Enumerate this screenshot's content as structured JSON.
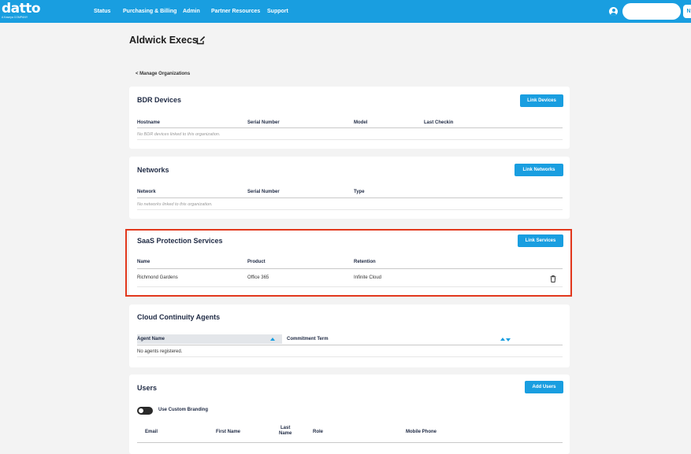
{
  "brand": {
    "logo": "datto",
    "logo_sub": "A Kaseya COMPANY"
  },
  "nav": {
    "items": [
      "Status",
      "Purchasing & Billing",
      "Admin",
      "Partner Resources",
      "Support"
    ]
  },
  "header": {
    "user_button": "N",
    "search_placeholder": ""
  },
  "page": {
    "title": "Aldwick Execs",
    "back_link": "< Manage Organizations"
  },
  "bdr": {
    "title": "BDR Devices",
    "button": "Link Devices",
    "columns": [
      "Hostname",
      "Serial Number",
      "Model",
      "Last Checkin"
    ],
    "empty": "No BDR devices linked to this organization."
  },
  "networks": {
    "title": "Networks",
    "button": "Link Networks",
    "columns": [
      "Network",
      "Serial Number",
      "Type"
    ],
    "empty": "No networks linked to this organization."
  },
  "saas": {
    "title": "SaaS Protection Services",
    "button": "Link Services",
    "columns": [
      "Name",
      "Product",
      "Retention"
    ],
    "rows": [
      {
        "name": "Richmond Gardens",
        "product": "Office 365",
        "retention": "Infinite Cloud"
      }
    ]
  },
  "cloud": {
    "title": "Cloud Continuity Agents",
    "columns": [
      "Agent Name",
      "Commitment Term"
    ],
    "empty": "No agents registered."
  },
  "users": {
    "title": "Users",
    "button": "Add Users",
    "toggle_label": "Use Custom Branding",
    "columns": [
      "Email",
      "First Name",
      "Last\nName",
      "Role",
      "Mobile Phone"
    ]
  },
  "colors": {
    "accent": "#199ee0",
    "highlight": "#e2381d",
    "background": "#f3f3f3"
  }
}
